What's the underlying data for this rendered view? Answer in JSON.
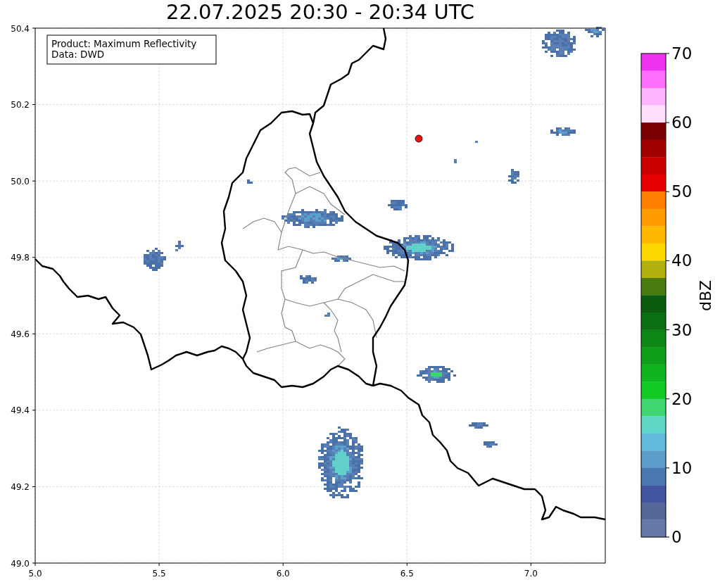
{
  "title": "22.07.2025 20:30 - 20:34 UTC",
  "map": {
    "annotation": [
      "Product: Maximum Reflectivity",
      "Data: DWD"
    ],
    "x_ticks": [
      "5.0",
      "5.5",
      "6.0",
      "6.5",
      "7.0"
    ],
    "y_ticks": [
      "50.4",
      "50.2",
      "50.0",
      "49.8",
      "49.6",
      "49.4",
      "49.2",
      "49.0"
    ]
  },
  "colorbar": {
    "label": "dBZ",
    "ticks": [
      "70",
      "60",
      "50",
      "40",
      "30",
      "20",
      "10",
      "0"
    ],
    "segments": [
      {
        "color": "#ee33ee"
      },
      {
        "color": "#ff6eff"
      },
      {
        "color": "#ffb4ff"
      },
      {
        "color": "#ffe0ff"
      },
      {
        "color": "#780000"
      },
      {
        "color": "#a00000"
      },
      {
        "color": "#c80000"
      },
      {
        "color": "#e60000"
      },
      {
        "color": "#ff7f00"
      },
      {
        "color": "#ff9c00"
      },
      {
        "color": "#ffb800"
      },
      {
        "color": "#ffd700"
      },
      {
        "color": "#b0b010"
      },
      {
        "color": "#4a7a12"
      },
      {
        "color": "#0a5a10"
      },
      {
        "color": "#0b6e13"
      },
      {
        "color": "#0c8716"
      },
      {
        "color": "#0e9e1a"
      },
      {
        "color": "#10b41e"
      },
      {
        "color": "#12c822"
      },
      {
        "color": "#3dd670"
      },
      {
        "color": "#60d6c6"
      },
      {
        "color": "#62bcdd"
      },
      {
        "color": "#5b9cc8"
      },
      {
        "color": "#4a78b0"
      },
      {
        "color": "#4255a0"
      },
      {
        "color": "#556699"
      },
      {
        "color": "#6677aa"
      }
    ]
  }
}
